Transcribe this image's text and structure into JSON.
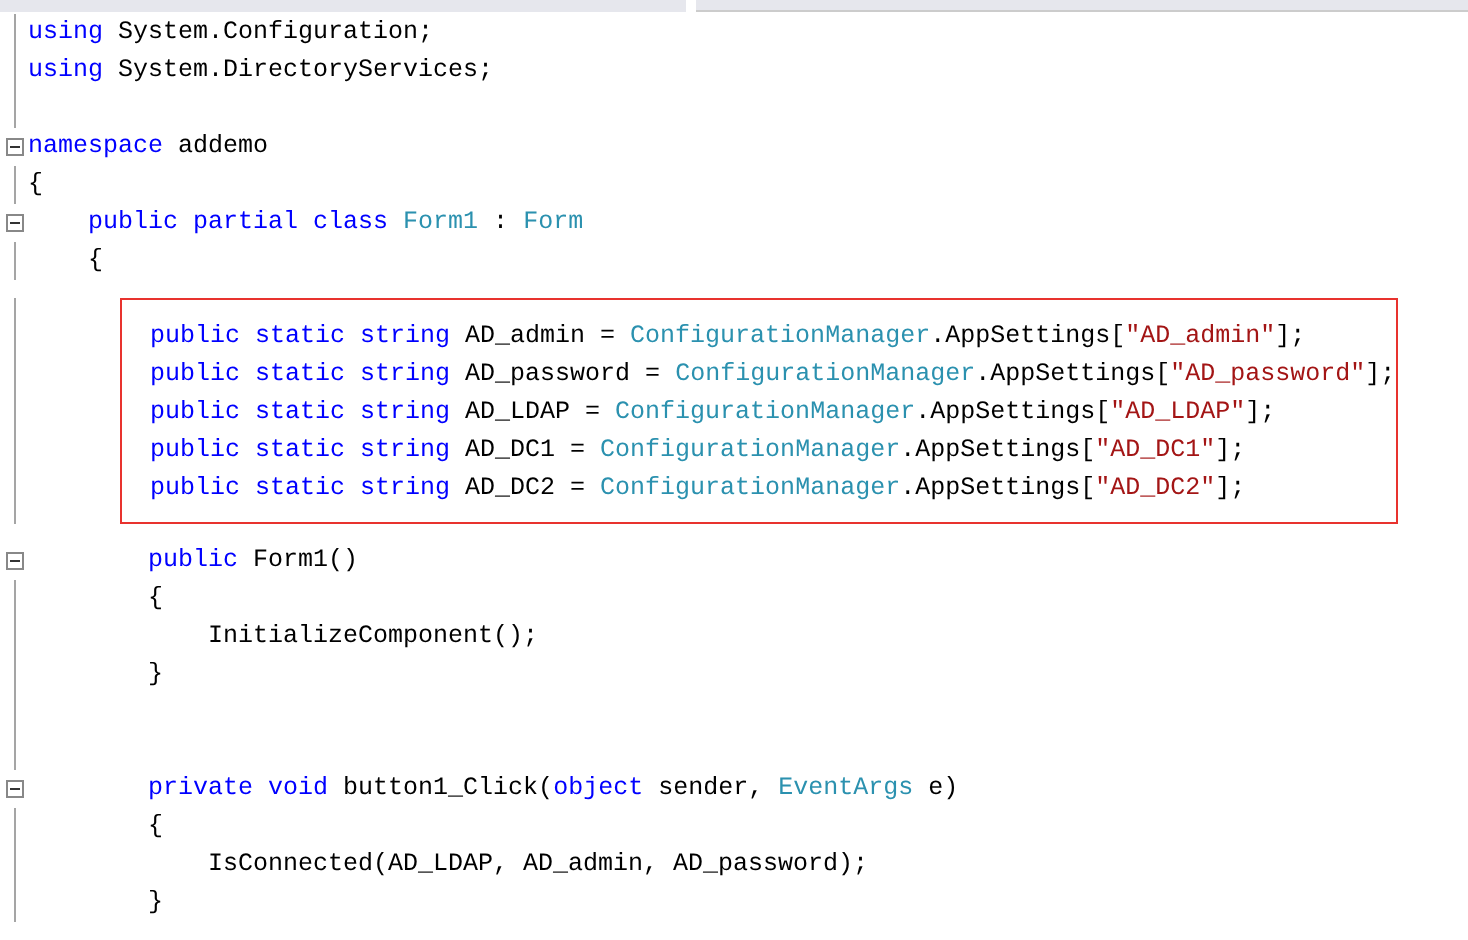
{
  "editor": {
    "lines": [
      {
        "kind": "code",
        "foldable": false,
        "tokens": [
          {
            "kind": "keyword",
            "text": "using "
          },
          {
            "kind": "plain",
            "text": "System.Configuration;"
          }
        ]
      },
      {
        "kind": "code",
        "foldable": false,
        "tokens": [
          {
            "kind": "keyword",
            "text": "using "
          },
          {
            "kind": "plain",
            "text": "System.DirectoryServices;"
          }
        ]
      },
      {
        "kind": "blank"
      },
      {
        "kind": "code",
        "foldable": true,
        "tokens": [
          {
            "kind": "keyword",
            "text": "namespace "
          },
          {
            "kind": "plain",
            "text": "addemo"
          }
        ],
        "open": "{",
        "children": [
          {
            "kind": "code",
            "foldable": true,
            "tokens": [
              {
                "kind": "keyword",
                "text": "public partial class "
              },
              {
                "kind": "type",
                "text": "Form1"
              },
              {
                "kind": "plain",
                "text": " : "
              },
              {
                "kind": "type",
                "text": "Form"
              }
            ],
            "open": "{",
            "children": [
              {
                "kind": "highlight",
                "lines": [
                  {
                    "tokens": [
                      {
                        "kind": "keyword",
                        "text": "public static string "
                      },
                      {
                        "kind": "plain",
                        "text": "AD_admin = "
                      },
                      {
                        "kind": "type",
                        "text": "ConfigurationManager"
                      },
                      {
                        "kind": "plain",
                        "text": ".AppSettings["
                      },
                      {
                        "kind": "string",
                        "text": "\"AD_admin\""
                      },
                      {
                        "kind": "plain",
                        "text": "];"
                      }
                    ]
                  },
                  {
                    "tokens": [
                      {
                        "kind": "keyword",
                        "text": "public static string "
                      },
                      {
                        "kind": "plain",
                        "text": "AD_password = "
                      },
                      {
                        "kind": "type",
                        "text": "ConfigurationManager"
                      },
                      {
                        "kind": "plain",
                        "text": ".AppSettings["
                      },
                      {
                        "kind": "string",
                        "text": "\"AD_password\""
                      },
                      {
                        "kind": "plain",
                        "text": "];"
                      }
                    ]
                  },
                  {
                    "tokens": [
                      {
                        "kind": "keyword",
                        "text": "public static string "
                      },
                      {
                        "kind": "plain",
                        "text": "AD_LDAP = "
                      },
                      {
                        "kind": "type",
                        "text": "ConfigurationManager"
                      },
                      {
                        "kind": "plain",
                        "text": ".AppSettings["
                      },
                      {
                        "kind": "string",
                        "text": "\"AD_LDAP\""
                      },
                      {
                        "kind": "plain",
                        "text": "];"
                      }
                    ]
                  },
                  {
                    "tokens": [
                      {
                        "kind": "keyword",
                        "text": "public static string "
                      },
                      {
                        "kind": "plain",
                        "text": "AD_DC1 = "
                      },
                      {
                        "kind": "type",
                        "text": "ConfigurationManager"
                      },
                      {
                        "kind": "plain",
                        "text": ".AppSettings["
                      },
                      {
                        "kind": "string",
                        "text": "\"AD_DC1\""
                      },
                      {
                        "kind": "plain",
                        "text": "];"
                      }
                    ]
                  },
                  {
                    "tokens": [
                      {
                        "kind": "keyword",
                        "text": "public static string "
                      },
                      {
                        "kind": "plain",
                        "text": "AD_DC2 = "
                      },
                      {
                        "kind": "type",
                        "text": "ConfigurationManager"
                      },
                      {
                        "kind": "plain",
                        "text": ".AppSettings["
                      },
                      {
                        "kind": "string",
                        "text": "\"AD_DC2\""
                      },
                      {
                        "kind": "plain",
                        "text": "];"
                      }
                    ]
                  }
                ]
              },
              {
                "kind": "code",
                "foldable": true,
                "tokens": [
                  {
                    "kind": "keyword",
                    "text": "public "
                  },
                  {
                    "kind": "plain",
                    "text": "Form1()"
                  }
                ],
                "open": "{",
                "children": [
                  {
                    "kind": "code",
                    "foldable": false,
                    "tokens": [
                      {
                        "kind": "plain",
                        "text": "InitializeComponent();"
                      }
                    ]
                  }
                ],
                "close": "}"
              },
              {
                "kind": "blank"
              },
              {
                "kind": "blank"
              },
              {
                "kind": "code",
                "foldable": true,
                "tokens": [
                  {
                    "kind": "keyword",
                    "text": "private void "
                  },
                  {
                    "kind": "plain",
                    "text": "button1_Click("
                  },
                  {
                    "kind": "keyword",
                    "text": "object "
                  },
                  {
                    "kind": "plain",
                    "text": "sender, "
                  },
                  {
                    "kind": "type",
                    "text": "EventArgs "
                  },
                  {
                    "kind": "plain",
                    "text": "e)"
                  }
                ],
                "open": "{",
                "children": [
                  {
                    "kind": "code",
                    "foldable": false,
                    "tokens": [
                      {
                        "kind": "plain",
                        "text": "IsConnected(AD_LDAP, AD_admin, AD_password);"
                      }
                    ]
                  }
                ],
                "close": "}"
              }
            ]
          }
        ]
      }
    ]
  }
}
